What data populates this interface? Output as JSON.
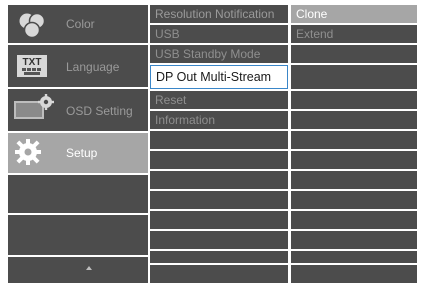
{
  "main_menu": {
    "items": [
      {
        "label": "Color",
        "icon": "color-circles-icon"
      },
      {
        "label": "Language",
        "icon": "txt-keyboard-icon"
      },
      {
        "label": "OSD Setting",
        "icon": "osd-monitor-gear-icon"
      },
      {
        "label": "Setup",
        "icon": "setup-gear-icon",
        "selected": true
      }
    ],
    "scroll_icon": "arrow-up-icon"
  },
  "sub_menu": {
    "items": [
      {
        "label": "Resolution Notification"
      },
      {
        "label": "USB"
      },
      {
        "label": "USB Standby Mode"
      },
      {
        "label": "DP Out Multi-Stream",
        "selected": true
      },
      {
        "label": "Reset"
      },
      {
        "label": "Information"
      }
    ]
  },
  "options_menu": {
    "items": [
      {
        "label": "Clone",
        "selected": true
      },
      {
        "label": "Extend"
      }
    ]
  },
  "colors": {
    "panel": "#4c4c4c",
    "highlight": "#a6a6a6",
    "focus_border": "#3a86c8"
  }
}
